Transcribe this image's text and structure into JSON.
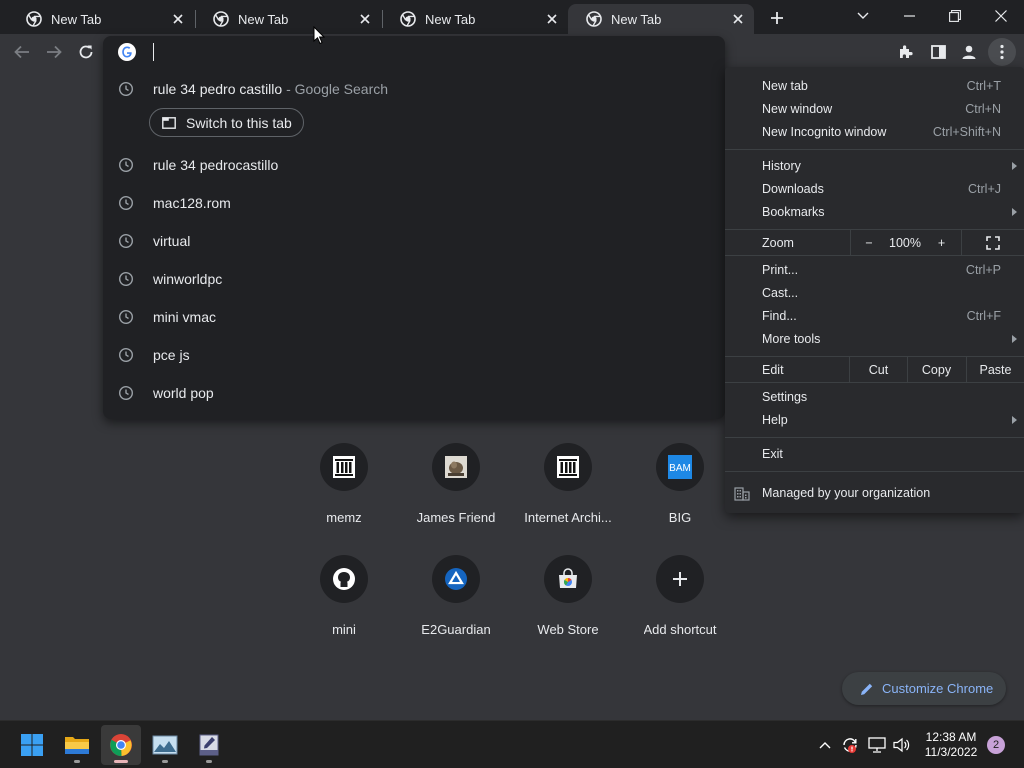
{
  "tabs": [
    {
      "title": "New Tab",
      "active": false
    },
    {
      "title": "New Tab",
      "active": false
    },
    {
      "title": "New Tab",
      "active": false
    },
    {
      "title": "New Tab",
      "active": true
    }
  ],
  "omnibox": {
    "value": "",
    "suggestions": [
      {
        "text": "rule 34 pedro castillo",
        "suffix": " - Google Search",
        "has_switch": true
      },
      {
        "text": "rule 34 pedrocastillo",
        "suffix": ""
      },
      {
        "text": "mac128.rom",
        "suffix": ""
      },
      {
        "text": "virtual",
        "suffix": ""
      },
      {
        "text": "winworldpc",
        "suffix": ""
      },
      {
        "text": "mini vmac",
        "suffix": ""
      },
      {
        "text": "pce js",
        "suffix": ""
      },
      {
        "text": "world pop",
        "suffix": ""
      }
    ],
    "switch_label": "Switch to this tab"
  },
  "shortcuts": [
    {
      "label": "memz",
      "icon": "archive-icon"
    },
    {
      "label": "James Friend",
      "icon": "thumbnail-icon"
    },
    {
      "label": "Internet Archi...",
      "icon": "archive-icon"
    },
    {
      "label": "BIG",
      "icon": "bam-icon"
    },
    {
      "label": "mini",
      "icon": "github-icon"
    },
    {
      "label": "E2Guardian",
      "icon": "e2guardian-icon"
    },
    {
      "label": "Web Store",
      "icon": "webstore-icon"
    },
    {
      "label": "Add shortcut",
      "icon": "plus-icon"
    }
  ],
  "customize": {
    "label": "Customize Chrome"
  },
  "menu": {
    "new_tab": {
      "label": "New tab",
      "shortcut": "Ctrl+T"
    },
    "new_window": {
      "label": "New window",
      "shortcut": "Ctrl+N"
    },
    "new_incognito": {
      "label": "New Incognito window",
      "shortcut": "Ctrl+Shift+N"
    },
    "history": {
      "label": "History"
    },
    "downloads": {
      "label": "Downloads",
      "shortcut": "Ctrl+J"
    },
    "bookmarks": {
      "label": "Bookmarks"
    },
    "zoom": {
      "label": "Zoom",
      "minus": "−",
      "value": "100%",
      "plus": "+"
    },
    "print": {
      "label": "Print...",
      "shortcut": "Ctrl+P"
    },
    "cast": {
      "label": "Cast..."
    },
    "find": {
      "label": "Find...",
      "shortcut": "Ctrl+F"
    },
    "more_tools": {
      "label": "More tools"
    },
    "edit": {
      "label": "Edit",
      "cut": "Cut",
      "copy": "Copy",
      "paste": "Paste"
    },
    "settings": {
      "label": "Settings"
    },
    "help": {
      "label": "Help"
    },
    "exit": {
      "label": "Exit"
    },
    "managed": {
      "label": "Managed by your organization"
    }
  },
  "taskbar": {
    "time": "12:38 AM",
    "date": "11/3/2022",
    "notifications": "2"
  },
  "colors": {
    "accent": "#8ab4f8",
    "background": "#35363a",
    "panel": "#202124",
    "menu": "#292a2d"
  }
}
